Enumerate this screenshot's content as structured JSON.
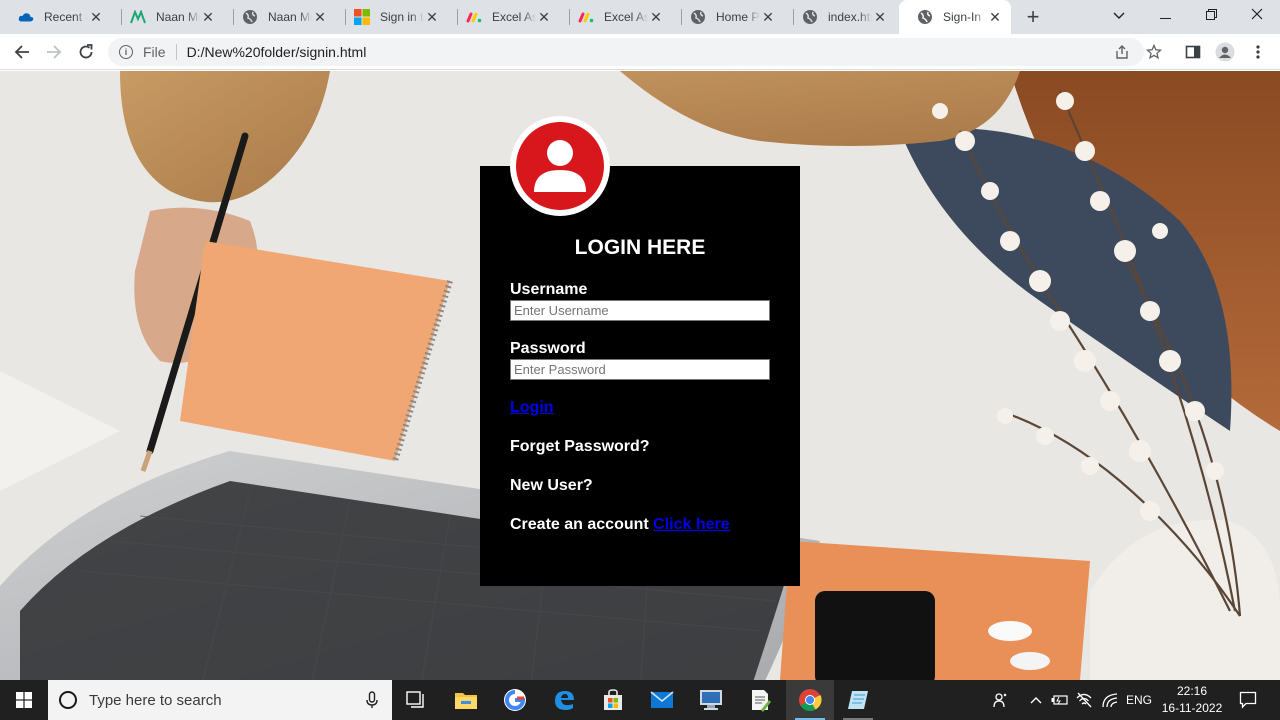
{
  "browser": {
    "tabs": [
      {
        "title": "Recent - OneDrive",
        "icon": "onedrive-icon",
        "active": false
      },
      {
        "title": "Naan Mudhalvan",
        "icon": "naan-mudhalvan-icon",
        "active": false
      },
      {
        "title": "Naan Mudhalvan",
        "icon": "globe-icon",
        "active": false
      },
      {
        "title": "Sign in to your account",
        "icon": "microsoft-icon",
        "active": false
      },
      {
        "title": "Excel Assignment",
        "icon": "monday-icon",
        "active": false
      },
      {
        "title": "Excel Assignment",
        "icon": "monday-icon",
        "active": false
      },
      {
        "title": "Home Page",
        "icon": "globe-icon",
        "active": false
      },
      {
        "title": "index.html",
        "icon": "globe-icon",
        "active": false
      },
      {
        "title": "Sign-In",
        "icon": "globe-icon",
        "active": true
      }
    ],
    "omnibox": {
      "scheme_label": "File",
      "url": "D:/New%20folder/signin.html"
    }
  },
  "page": {
    "title": "LOGIN HERE",
    "username_label": "Username",
    "username_placeholder": "Enter Username",
    "password_label": "Password",
    "password_placeholder": "Enter Password",
    "login_link": "Login",
    "forget_password": "Forget Password?",
    "new_user": "New User?",
    "create_account": "Create an account",
    "click_here": "Click here",
    "colors": {
      "box": "#000000",
      "avatar": "#d7171b",
      "link": "#0000ee"
    }
  },
  "taskbar": {
    "search_placeholder": "Type here to search",
    "language": "ENG",
    "time": "22:16",
    "date": "16-11-2022"
  }
}
